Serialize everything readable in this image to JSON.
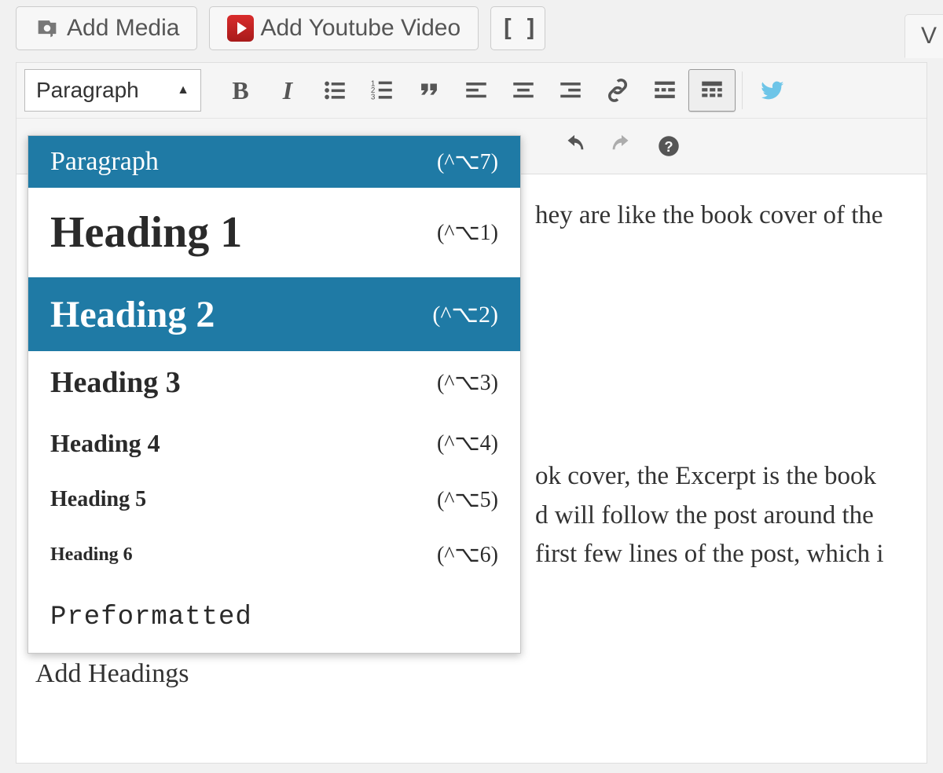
{
  "topbar": {
    "add_media": "Add Media",
    "add_youtube": "Add Youtube Video"
  },
  "tab_right": "V",
  "format_selected": "Paragraph",
  "dropdown": [
    {
      "label": "Paragraph",
      "shortcut": "(^⌥7)",
      "cls": "dd-paragraph",
      "selected": true
    },
    {
      "label": "Heading 1",
      "shortcut": "(^⌥1)",
      "cls": "dd-h1",
      "selected": false
    },
    {
      "label": "Heading 2",
      "shortcut": "(^⌥2)",
      "cls": "dd-h2",
      "selected": true
    },
    {
      "label": "Heading 3",
      "shortcut": "(^⌥3)",
      "cls": "dd-h3",
      "selected": false
    },
    {
      "label": "Heading 4",
      "shortcut": "(^⌥4)",
      "cls": "dd-h4",
      "selected": false
    },
    {
      "label": "Heading 5",
      "shortcut": "(^⌥5)",
      "cls": "dd-h5",
      "selected": false
    },
    {
      "label": "Heading 6",
      "shortcut": "(^⌥6)",
      "cls": "dd-h6",
      "selected": false
    },
    {
      "label": "Preformatted",
      "shortcut": "",
      "cls": "dd-pre",
      "selected": false
    }
  ],
  "content": {
    "line1": "hey are like the book cover of the",
    "para2_l1": "ok cover, the Excerpt is the book",
    "para2_l2": "d will follow the post around the",
    "para2_l3": "first few lines of the post, which i",
    "heading_label": "Add Headings"
  }
}
